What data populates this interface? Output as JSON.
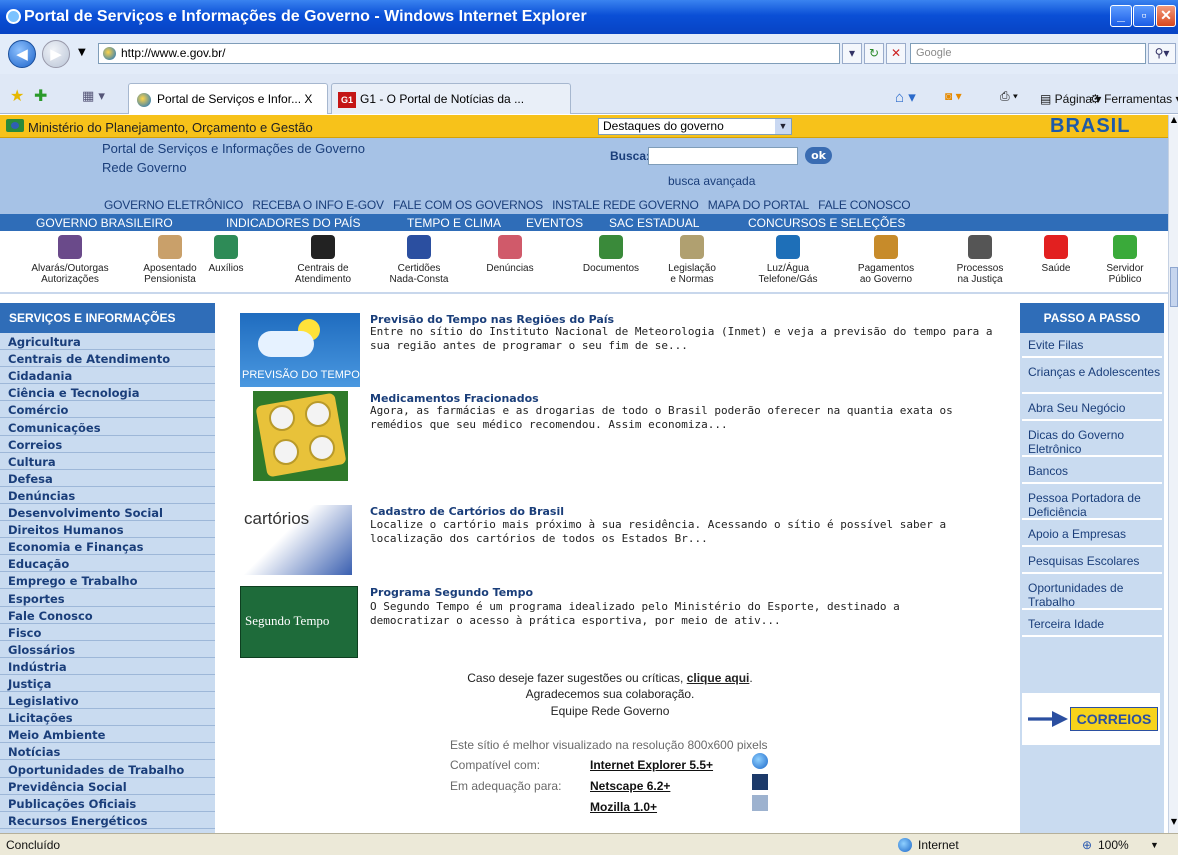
{
  "window": {
    "title": "Portal de Serviços e Informações de Governo - Windows Internet Explorer"
  },
  "browser": {
    "url": "http://www.e.gov.br/",
    "search_placeholder": "Google",
    "tabs": [
      {
        "label": "Portal de Serviços e Infor...  X"
      },
      {
        "label": "G1 - O Portal de Notícias da ..."
      }
    ],
    "tools": {
      "page": "Página",
      "tools": "Ferramentas"
    }
  },
  "gov": {
    "ministry": "Ministério do Planejamento, Orçamento e Gestão",
    "highlights": "Destaques do governo",
    "brasil": "BRASIL"
  },
  "header": {
    "portal": "Portal de Serviços e Informações de Governo",
    "rede": "Rede Governo",
    "busca_label": "Busca:",
    "ok": "ok",
    "advanced": "busca avançada"
  },
  "toplinks": [
    "GOVERNO ELETRÔNICO",
    "RECEBA O INFO E-GOV",
    "FALE COM OS GOVERNOS",
    "INSTALE REDE GOVERNO",
    "MAPA DO PORTAL",
    "FALE CONOSCO"
  ],
  "nav": [
    "GOVERNO BRASILEIRO",
    "INDICADORES DO PAÍS",
    "TEMPO E CLIMA",
    "EVENTOS",
    "SAC ESTADUAL",
    "CONCURSOS E SELEÇÕES"
  ],
  "icons": [
    {
      "l1": "Alvarás/Outorgas",
      "l2": "Autorizações",
      "color": "#6a4a8a"
    },
    {
      "l1": "Aposentado",
      "l2": "Pensionista",
      "color": "#c9a06a"
    },
    {
      "l1": "Auxílios",
      "l2": "",
      "color": "#2e8b57"
    },
    {
      "l1": "Centrais de",
      "l2": "Atendimento",
      "color": "#222222"
    },
    {
      "l1": "Certidões",
      "l2": "Nada-Consta",
      "color": "#2b4fa0"
    },
    {
      "l1": "Denúncias",
      "l2": "",
      "color": "#d05a6a"
    },
    {
      "l1": "Documentos",
      "l2": "",
      "color": "#3a8a3a"
    },
    {
      "l1": "Legislação",
      "l2": "e Normas",
      "color": "#b0a070"
    },
    {
      "l1": "Luz/Água",
      "l2": "Telefone/Gás",
      "color": "#1e6fb8"
    },
    {
      "l1": "Pagamentos",
      "l2": "ao Governo",
      "color": "#c78b2a"
    },
    {
      "l1": "Processos",
      "l2": "na Justiça",
      "color": "#555555"
    },
    {
      "l1": "Saúde",
      "l2": "",
      "color": "#e22020"
    },
    {
      "l1": "Servidor",
      "l2": "Público",
      "color": "#3aaa3a"
    }
  ],
  "left": {
    "title": "SERVIÇOS E INFORMAÇÕES",
    "items": [
      "Agricultura",
      "Centrais de Atendimento",
      "Cidadania",
      "Ciência e Tecnologia",
      "Comércio",
      "Comunicações",
      "Correios",
      "Cultura",
      "Defesa",
      "Denúncias",
      "Desenvolvimento Social",
      "Direitos Humanos",
      "Economia e Finanças",
      "Educação",
      "Emprego e Trabalho",
      "Esportes",
      "Fale Conosco",
      "Fisco",
      "Glossários",
      "Indústria",
      "Justiça",
      "Legislativo",
      "Licitações",
      "Meio Ambiente",
      "Notícias",
      "Oportunidades de Trabalho",
      "Previdência Social",
      "Publicações Oficiais",
      "Recursos Energéticos"
    ]
  },
  "right": {
    "title": "PASSO A PASSO",
    "items": [
      "Evite Filas",
      "Crianças e Adolescentes",
      "Abra Seu Negócio",
      "Dicas do Governo Eletrônico",
      "Bancos",
      "Pessoa Portadora de Deficiência",
      "Apoio a Empresas",
      "Pesquisas Escolares",
      "Oportunidades de Trabalho",
      "Terceira Idade"
    ],
    "correios": "CORREIOS"
  },
  "news": [
    {
      "title": "Previsão do Tempo nas Regiões do País",
      "l1": "Entre no sítio do Instituto Nacional de Meteorologia (Inmet) e veja a previsão do tempo para a",
      "l2": "sua região antes de programar o seu fim de se...",
      "img": "PREVISÃO DO TEMPO"
    },
    {
      "title": "Medicamentos Fracionados",
      "l1": "Agora, as farmácias e as drogarias de todo o Brasil poderão oferecer na quantia exata os",
      "l2": "remédios que seu médico recomendou. Assim economiza...",
      "img": ""
    },
    {
      "title": "Cadastro de Cartórios do Brasil",
      "l1": "Localize o cartório mais próximo à sua residência. Acessando o sítio é possível saber a",
      "l2": "localização dos cartórios de todos os Estados Br...",
      "img": "cartórios"
    },
    {
      "title": "Programa Segundo Tempo",
      "l1": "O Segundo Tempo é um programa idealizado pelo Ministério do Esporte, destinado a",
      "l2": "democratizar o acesso à prática esportiva, por meio de ativ...",
      "img": "Segundo Tempo"
    }
  ],
  "feedback": {
    "pre": "Caso deseje fazer sugestões ou críticas, ",
    "link": "clique aqui",
    "post": ".",
    "thanks": "Agradecemos sua colaboração.",
    "team": "Equipe Rede Governo"
  },
  "compat": {
    "res": "Este sítio é melhor visualizado na resolução 800x600 pixels",
    "comp": "Compatível com:",
    "adeq": "Em adequação para:",
    "ie": "Internet Explorer 5.5+",
    "ns": "Netscape 6.2+",
    "moz": "Mozilla 1.0+"
  },
  "status": {
    "left": "Concluído",
    "zone": "Internet",
    "zoom": "100%"
  }
}
